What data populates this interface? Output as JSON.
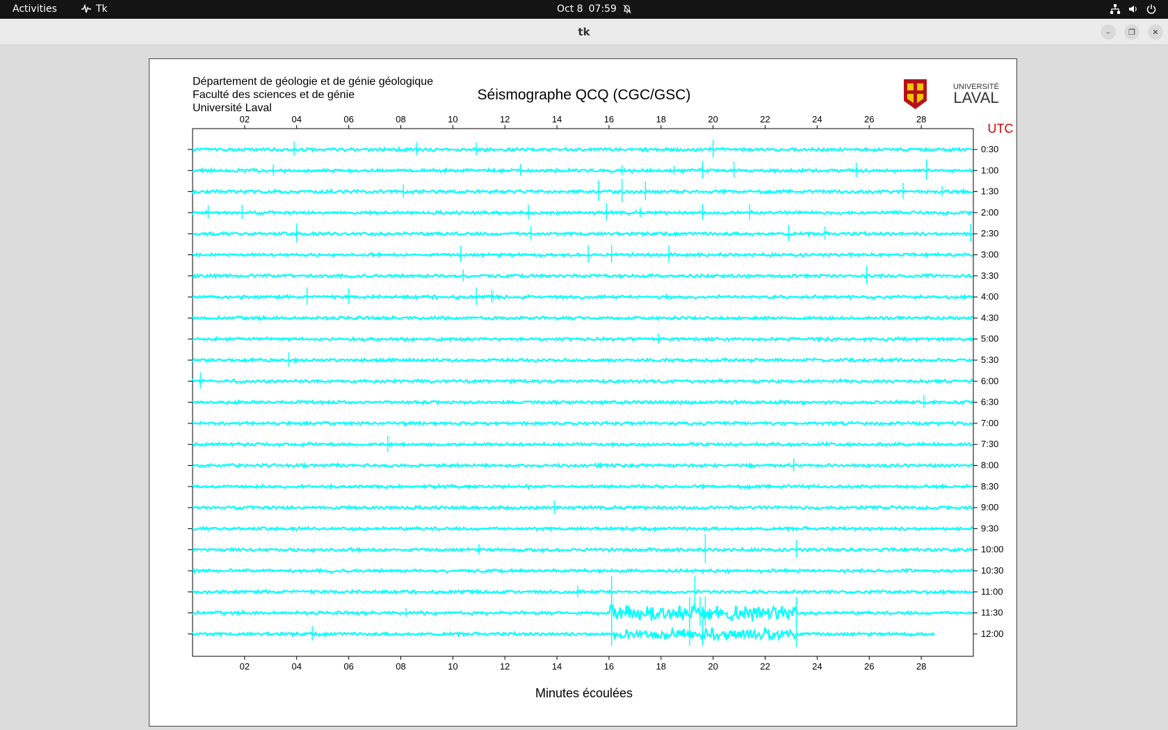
{
  "topbar": {
    "activities": "Activities",
    "app_name": "Tk",
    "date": "Oct 8",
    "time": "07:59"
  },
  "window": {
    "title": "tk"
  },
  "header": {
    "dept_line1": "Département de géologie et de génie géologique",
    "dept_line2": "Faculté des sciences et de génie",
    "dept_line3": "Université Laval",
    "logo_line1": "UNIVERSITÉ",
    "logo_line2": "LAVAL"
  },
  "chart_data": {
    "type": "line",
    "title": "Séismographe QCQ (CGC/GSC)",
    "xlabel": "Minutes écoulées",
    "ylabel": "UTC",
    "xlim": [
      0,
      30
    ],
    "x_ticks": [
      "02",
      "04",
      "06",
      "08",
      "10",
      "12",
      "14",
      "16",
      "18",
      "20",
      "22",
      "24",
      "26",
      "28"
    ],
    "x_tick_values": [
      2,
      4,
      6,
      8,
      10,
      12,
      14,
      16,
      18,
      20,
      22,
      24,
      26,
      28
    ],
    "trace_color": "#00ffff",
    "grid": false,
    "traces": [
      {
        "label": "0:30",
        "spikes": [
          [
            3.9,
            0.5
          ],
          [
            8.6,
            0.45
          ],
          [
            10.9,
            0.45
          ],
          [
            20.0,
            0.6
          ],
          [
            23.8,
            0.15
          ]
        ],
        "bursts": []
      },
      {
        "label": "1:00",
        "spikes": [
          [
            3.1,
            0.4
          ],
          [
            12.6,
            0.4
          ],
          [
            16.5,
            0.35
          ],
          [
            18.5,
            0.3
          ],
          [
            19.6,
            0.6
          ],
          [
            20.8,
            0.55
          ],
          [
            25.5,
            0.5
          ],
          [
            28.2,
            0.7
          ]
        ],
        "bursts": []
      },
      {
        "label": "1:30",
        "spikes": [
          [
            8.1,
            0.45
          ],
          [
            15.6,
            0.7
          ],
          [
            16.5,
            0.8
          ],
          [
            17.4,
            0.65
          ],
          [
            27.3,
            0.55
          ],
          [
            28.8,
            0.35
          ]
        ],
        "bursts": []
      },
      {
        "label": "2:00",
        "spikes": [
          [
            0.6,
            0.45
          ],
          [
            1.9,
            0.5
          ],
          [
            12.9,
            0.5
          ],
          [
            15.9,
            0.6
          ],
          [
            17.2,
            0.35
          ],
          [
            19.6,
            0.55
          ],
          [
            21.4,
            0.55
          ]
        ],
        "bursts": []
      },
      {
        "label": "2:30",
        "spikes": [
          [
            4.0,
            0.65
          ],
          [
            13.0,
            0.5
          ],
          [
            22.9,
            0.55
          ],
          [
            24.3,
            0.45
          ],
          [
            29.9,
            0.6
          ]
        ],
        "bursts": []
      },
      {
        "label": "3:00",
        "spikes": [
          [
            10.3,
            0.55
          ],
          [
            15.2,
            0.6
          ],
          [
            16.1,
            0.6
          ],
          [
            18.3,
            0.6
          ]
        ],
        "bursts": []
      },
      {
        "label": "3:30",
        "spikes": [
          [
            10.4,
            0.4
          ],
          [
            25.9,
            0.65
          ]
        ],
        "bursts": []
      },
      {
        "label": "4:00",
        "spikes": [
          [
            4.4,
            0.6
          ],
          [
            6.0,
            0.55
          ],
          [
            10.9,
            0.6
          ],
          [
            11.5,
            0.45
          ],
          [
            18.2,
            0.2
          ]
        ],
        "bursts": []
      },
      {
        "label": "4:30",
        "spikes": [],
        "bursts": []
      },
      {
        "label": "5:00",
        "spikes": [
          [
            17.9,
            0.35
          ]
        ],
        "bursts": []
      },
      {
        "label": "5:30",
        "spikes": [
          [
            3.7,
            0.5
          ]
        ],
        "bursts": []
      },
      {
        "label": "6:00",
        "spikes": [
          [
            0.3,
            0.55
          ]
        ],
        "bursts": []
      },
      {
        "label": "6:30",
        "spikes": [
          [
            28.1,
            0.45
          ]
        ],
        "bursts": []
      },
      {
        "label": "7:00",
        "spikes": [],
        "bursts": []
      },
      {
        "label": "7:30",
        "spikes": [
          [
            7.5,
            0.55
          ]
        ],
        "bursts": []
      },
      {
        "label": "8:00",
        "spikes": [
          [
            23.1,
            0.45
          ]
        ],
        "bursts": []
      },
      {
        "label": "8:30",
        "spikes": [],
        "bursts": []
      },
      {
        "label": "9:00",
        "spikes": [
          [
            13.9,
            0.45
          ]
        ],
        "bursts": []
      },
      {
        "label": "9:30",
        "spikes": [],
        "bursts": []
      },
      {
        "label": "10:00",
        "spikes": [
          [
            11.0,
            0.35
          ],
          [
            19.7,
            1.0
          ],
          [
            23.2,
            0.6
          ]
        ],
        "bursts": []
      },
      {
        "label": "10:30",
        "spikes": [],
        "bursts": []
      },
      {
        "label": "11:00",
        "spikes": [
          [
            14.8,
            0.4
          ],
          [
            16.1,
            1.0
          ],
          [
            19.3,
            1.0
          ]
        ],
        "bursts": []
      },
      {
        "label": "11:30",
        "spikes": [
          [
            8.2,
            0.3
          ],
          [
            16.1,
            1.0
          ],
          [
            19.1,
            1.0
          ],
          [
            19.5,
            1.0
          ],
          [
            19.7,
            1.0
          ],
          [
            23.2,
            1.0
          ]
        ],
        "bursts": [
          [
            16.0,
            23.2,
            0.6
          ]
        ]
      },
      {
        "label": "12:00",
        "spikes": [
          [
            4.6,
            0.5
          ],
          [
            16.1,
            0.9
          ],
          [
            19.1,
            0.9
          ],
          [
            19.6,
            0.9
          ],
          [
            23.2,
            1.0
          ]
        ],
        "bursts": [
          [
            16.2,
            23.2,
            0.45
          ]
        ],
        "end": 28.5
      }
    ]
  }
}
